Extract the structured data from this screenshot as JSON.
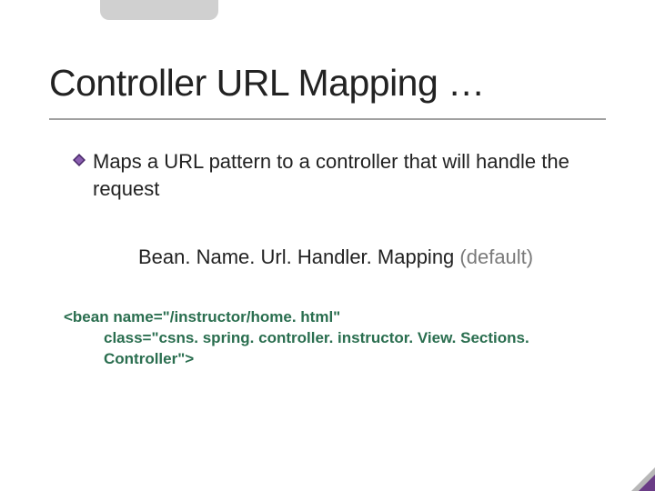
{
  "title": "Controller URL Mapping …",
  "bullet": {
    "text": "Maps a URL pattern to a controller that will handle the request"
  },
  "subheading": {
    "name": "Bean. Name. Url. Handler. Mapping",
    "suffix": " (default)"
  },
  "code": {
    "line1": "<bean name=\"/instructor/home. html\"",
    "line2": "class=\"csns. spring. controller. instructor. View. Sections. Controller\">"
  }
}
